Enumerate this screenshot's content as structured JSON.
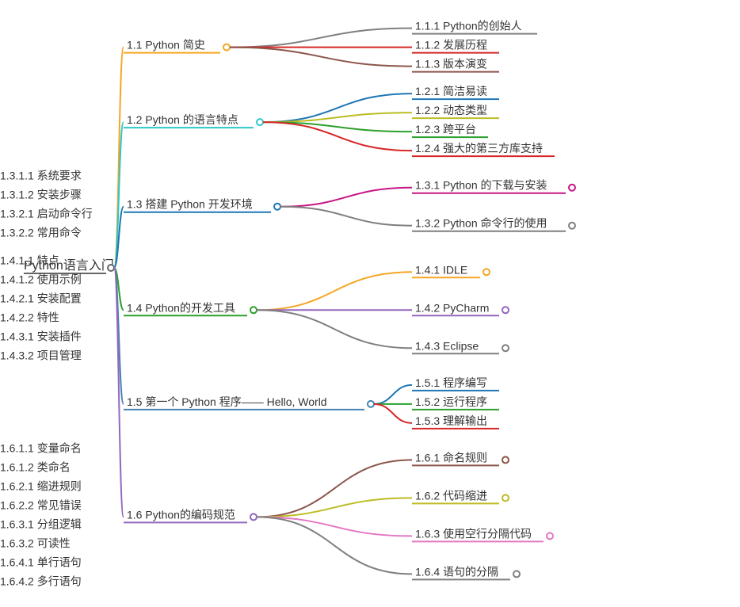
{
  "chart_data": {
    "type": "mindmap",
    "root": "Python语言入门",
    "colors": {
      "orange": "#f5a623",
      "teal": "#2ec7c9",
      "blue": "#1f77b4",
      "green": "#2ca02c",
      "purple": "#9467bd",
      "red": "#d62728",
      "brown": "#8c564b",
      "olive": "#bcbd22",
      "gray": "#7f7f7f",
      "magenta": "#c71585",
      "steel": "#4682b4",
      "pink": "#e377c2"
    },
    "branches": [
      {
        "label": "1.1 Python 简史",
        "color": "orange",
        "children": [
          {
            "label": "1.1.1 Python的创始人",
            "color": "gray"
          },
          {
            "label": "1.1.2 发展历程",
            "color": "red"
          },
          {
            "label": "1.1.3 版本演变",
            "color": "brown"
          }
        ]
      },
      {
        "label": "1.2 Python 的语言特点",
        "color": "teal",
        "children": [
          {
            "label": "1.2.1 简洁易读",
            "color": "blue"
          },
          {
            "label": "1.2.2 动态类型",
            "color": "olive"
          },
          {
            "label": "1.2.3 跨平台",
            "color": "green"
          },
          {
            "label": "1.2.4 强大的第三方库支持",
            "color": "red"
          }
        ]
      },
      {
        "label": "1.3 搭建 Python 开发环境",
        "color": "blue",
        "children": [
          {
            "label": "1.3.1 Python 的下载与安装",
            "color": "magenta",
            "children": [
              {
                "label": "1.3.1.1 系统要求",
                "color": "brown"
              },
              {
                "label": "1.3.1.2 安装步骤",
                "color": "red"
              }
            ]
          },
          {
            "label": "1.3.2 Python 命令行的使用",
            "color": "gray",
            "children": [
              {
                "label": "1.3.2.1 启动命令行",
                "color": "olive"
              },
              {
                "label": "1.3.2.2 常用命令",
                "color": "teal"
              }
            ]
          }
        ]
      },
      {
        "label": "1.4 Python的开发工具",
        "color": "green",
        "children": [
          {
            "label": "1.4.1 IDLE",
            "color": "orange",
            "children": [
              {
                "label": "1.4.1.1 特点",
                "color": "green"
              },
              {
                "label": "1.4.1.2 使用示例",
                "color": "red"
              }
            ]
          },
          {
            "label": "1.4.2 PyCharm",
            "color": "purple",
            "children": [
              {
                "label": "1.4.2.1 安装配置",
                "color": "brown"
              },
              {
                "label": "1.4.2.2 特性",
                "color": "gray"
              }
            ]
          },
          {
            "label": "1.4.3 Eclipse",
            "color": "gray",
            "children": [
              {
                "label": "1.4.3.1 安装插件",
                "color": "olive"
              },
              {
                "label": "1.4.3.2 项目管理",
                "color": "teal"
              }
            ]
          }
        ]
      },
      {
        "label": "1.5 第一个 Python 程序—— Hello, World",
        "color": "steel",
        "children": [
          {
            "label": "1.5.1 程序编写",
            "color": "blue"
          },
          {
            "label": "1.5.2 运行程序",
            "color": "green"
          },
          {
            "label": "1.5.3 理解输出",
            "color": "red"
          }
        ]
      },
      {
        "label": "1.6 Python的编码规范",
        "color": "purple",
        "children": [
          {
            "label": "1.6.1 命名规则",
            "color": "brown",
            "children": [
              {
                "label": "1.6.1.1 变量命名",
                "color": "gray"
              },
              {
                "label": "1.6.1.2 类命名",
                "color": "red"
              }
            ]
          },
          {
            "label": "1.6.2 代码缩进",
            "color": "olive",
            "children": [
              {
                "label": "1.6.2.1 缩进规则",
                "color": "teal"
              },
              {
                "label": "1.6.2.2 常见错误",
                "color": "blue"
              }
            ]
          },
          {
            "label": "1.6.3 使用空行分隔代码",
            "color": "pink",
            "children": [
              {
                "label": "1.6.3.1 分组逻辑",
                "color": "red"
              },
              {
                "label": "1.6.3.2 可读性",
                "color": "brown"
              }
            ]
          },
          {
            "label": "1.6.4 语句的分隔",
            "color": "gray",
            "children": [
              {
                "label": "1.6.4.1 单行语句",
                "color": "olive"
              },
              {
                "label": "1.6.4.2 多行语句",
                "color": "teal"
              }
            ]
          }
        ]
      }
    ]
  }
}
